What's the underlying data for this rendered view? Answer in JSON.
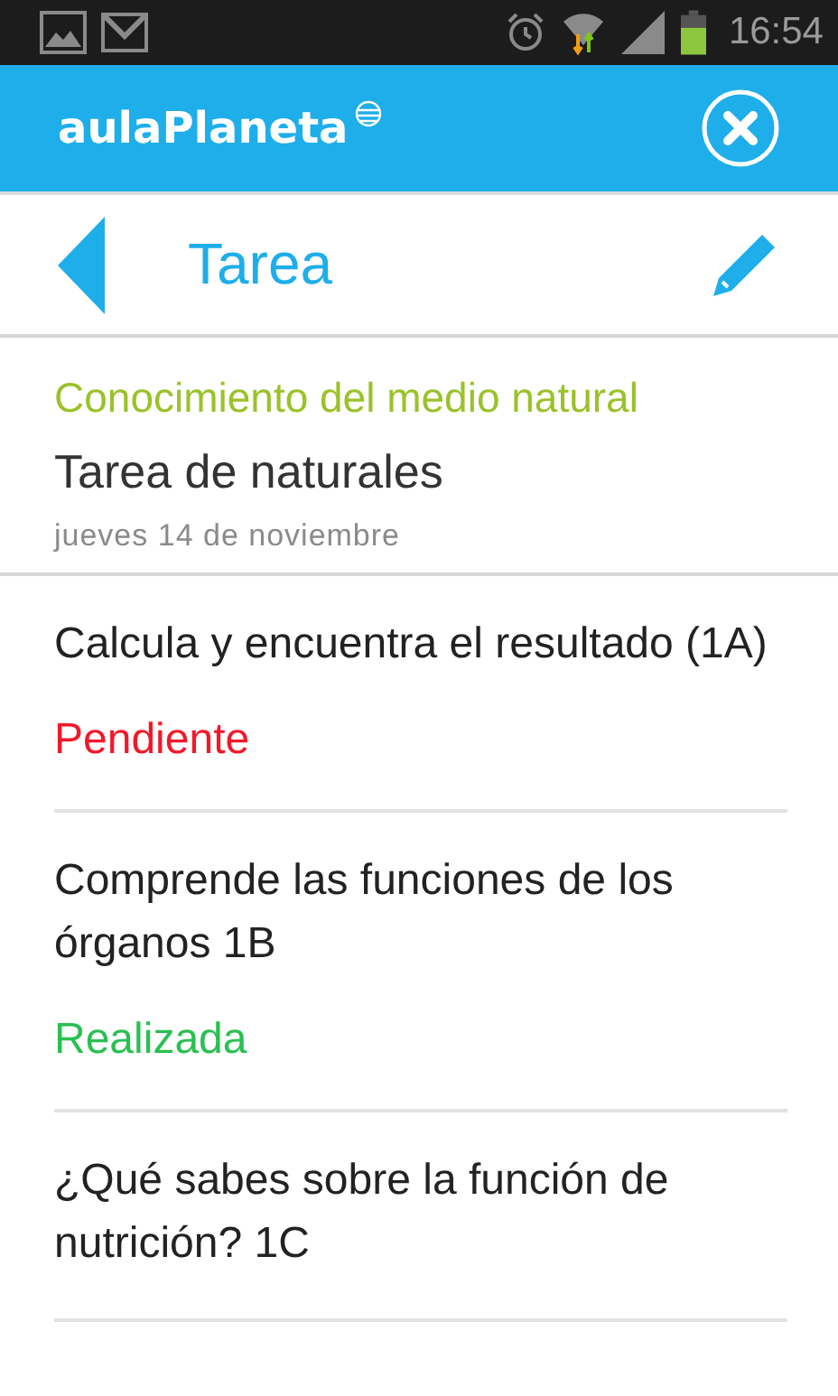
{
  "status_bar": {
    "time": "16:54"
  },
  "app_bar": {
    "logo": "aulaPlaneta"
  },
  "title_bar": {
    "title": "Tarea"
  },
  "task": {
    "subject": "Conocimiento del medio natural",
    "name": "Tarea de naturales",
    "date": "jueves 14 de noviembre"
  },
  "activities": [
    {
      "title": "Calcula y encuentra el resultado (1A)",
      "status": "Pendiente",
      "kind": "pending"
    },
    {
      "title": "Comprende las funciones de los órganos 1B",
      "status": "Realizada",
      "kind": "done"
    },
    {
      "title": "¿Qué sabes sobre la función de nutrición? 1C"
    }
  ]
}
